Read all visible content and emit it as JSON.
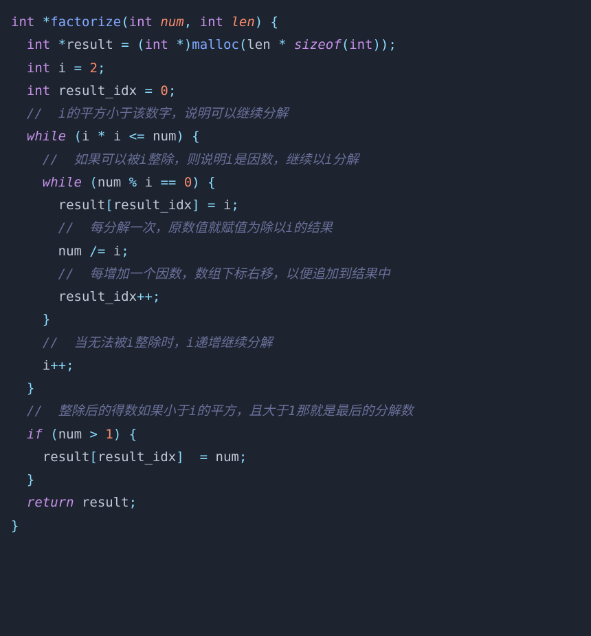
{
  "code": {
    "line1": {
      "int": "int",
      "star": "*",
      "factorize": "factorize",
      "lparen": "(",
      "int2": "int",
      "num": "num",
      "comma": ",",
      "int3": "int",
      "len": "len",
      "rparen": ")",
      "lbrace": "{"
    },
    "line2": {
      "int": "int",
      "star": "*",
      "result": "result",
      "eq": "=",
      "lparen": "(",
      "int2": "int",
      "star2": "*",
      "rparen": ")",
      "malloc": "malloc",
      "lparen2": "(",
      "len": "len",
      "mul": "*",
      "sizeof": "sizeof",
      "lparen3": "(",
      "int3": "int",
      "rparen2": ")",
      "rparen3": ")",
      "semi": ";"
    },
    "line3": {
      "int": "int",
      "i": "i",
      "eq": "=",
      "two": "2",
      "semi": ";"
    },
    "line4": {
      "int": "int",
      "result_idx": "result_idx",
      "eq": "=",
      "zero": "0",
      "semi": ";"
    },
    "line5": {
      "comment": "//  i的平方小于该数字，说明可以继续分解"
    },
    "line6": {
      "while": "while",
      "lparen": "(",
      "i": "i",
      "mul": "*",
      "i2": "i",
      "lte": "<=",
      "num": "num",
      "rparen": ")",
      "lbrace": "{"
    },
    "line7": {
      "comment": "//  如果可以被i整除，则说明i是因数，继续以i分解"
    },
    "line8": {
      "while": "while",
      "lparen": "(",
      "num": "num",
      "mod": "%",
      "i": "i",
      "eqeq": "==",
      "zero": "0",
      "rparen": ")",
      "lbrace": "{"
    },
    "line9": {
      "result": "result",
      "lbrack": "[",
      "result_idx": "result_idx",
      "rbrack": "]",
      "eq": "=",
      "i": "i",
      "semi": ";"
    },
    "line10": {
      "comment": "//  每分解一次，原数值就赋值为除以i的结果"
    },
    "line11": {
      "num": "num",
      "diveq": "/=",
      "i": "i",
      "semi": ";"
    },
    "line12": {
      "comment": "//  每增加一个因数，数组下标右移，以便追加到结果中"
    },
    "line13": {
      "result_idx": "result_idx",
      "inc": "++",
      "semi": ";"
    },
    "line14": {
      "rbrace": "}"
    },
    "line15": {
      "comment": "//  当无法被i整除时，i递增继续分解"
    },
    "line16": {
      "i": "i",
      "inc": "++",
      "semi": ";"
    },
    "line17": {
      "rbrace": "}"
    },
    "line18": {
      "comment": "//  整除后的得数如果小于i的平方，且大于1那就是最后的分解数"
    },
    "line19": {
      "if": "if",
      "lparen": "(",
      "num": "num",
      "gt": ">",
      "one": "1",
      "rparen": ")",
      "lbrace": "{"
    },
    "line20": {
      "result": "result",
      "lbrack": "[",
      "result_idx": "result_idx",
      "rbrack": "]",
      "eq": "=",
      "num": "num",
      "semi": ";"
    },
    "line21": {
      "rbrace": "}"
    },
    "line22": {
      "return": "return",
      "result": "result",
      "semi": ";"
    },
    "line23": {
      "rbrace": "}"
    }
  }
}
